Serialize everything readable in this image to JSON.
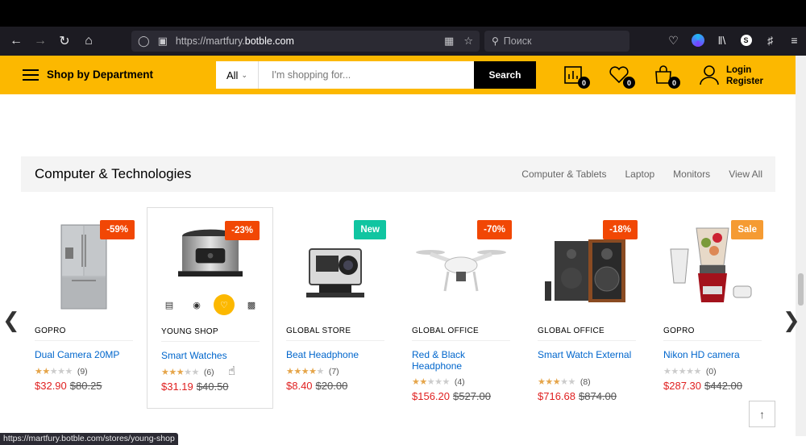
{
  "browser": {
    "url_prefix": "https://martfury.",
    "url_domain": "botble.com",
    "search_placeholder": "Поиск",
    "status_url": "https://martfury.botble.com/stores/young-shop"
  },
  "header": {
    "department_label": "Shop by Department",
    "search_category": "All",
    "search_placeholder": "I'm shopping for...",
    "search_button": "Search",
    "compare_count": "0",
    "wishlist_count": "0",
    "cart_count": "0",
    "login_label": "Login",
    "register_label": "Register",
    "brand_color": "#fcb800"
  },
  "section": {
    "title": "Computer & Technologies",
    "links": [
      "Computer & Tablets",
      "Laptop",
      "Monitors",
      "View All"
    ]
  },
  "products": [
    {
      "vendor": "GOPRO",
      "name": "Dual Camera 20MP",
      "badge": "-59%",
      "badge_color": "#f14705",
      "rating": 2,
      "reviews": "(9)",
      "price": "$32.90",
      "old_price": "$80.25"
    },
    {
      "vendor": "YOUNG SHOP",
      "name": "Smart Watches",
      "badge": "-23%",
      "badge_color": "#f14705",
      "rating": 3,
      "reviews": "(6)",
      "price": "$31.19",
      "old_price": "$40.50"
    },
    {
      "vendor": "GLOBAL STORE",
      "name": "Beat Headphone",
      "badge": "New",
      "badge_color": "#10c5a1",
      "rating": 4,
      "reviews": "(7)",
      "price": "$8.40",
      "old_price": "$20.00"
    },
    {
      "vendor": "GLOBAL OFFICE",
      "name": "Red & Black Headphone",
      "badge": "-70%",
      "badge_color": "#f14705",
      "rating": 2,
      "reviews": "(4)",
      "price": "$156.20",
      "old_price": "$527.00"
    },
    {
      "vendor": "GLOBAL OFFICE",
      "name": "Smart Watch External",
      "badge": "-18%",
      "badge_color": "#f14705",
      "rating": 3,
      "reviews": "(8)",
      "price": "$716.68",
      "old_price": "$874.00"
    },
    {
      "vendor": "GOPRO",
      "name": "Nikon HD camera",
      "badge": "Sale",
      "badge_color": "#f59b33",
      "rating": 0,
      "reviews": "(0)",
      "price": "$287.30",
      "old_price": "$442.00"
    }
  ]
}
